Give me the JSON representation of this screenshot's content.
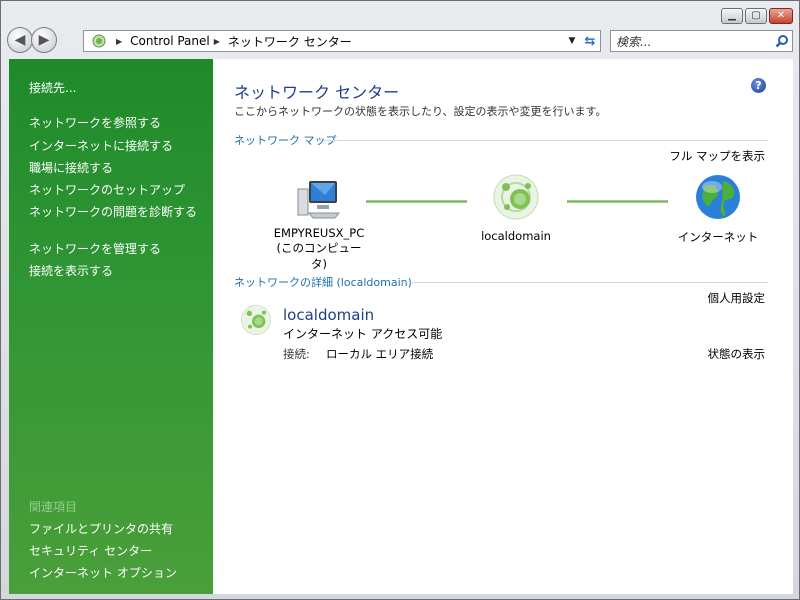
{
  "address": {
    "crumbs": [
      "Control Panel",
      "ネットワーク センター"
    ]
  },
  "search": {
    "placeholder": "検索..."
  },
  "sidebar": {
    "tasks": [
      "接続先...",
      "ネットワークを参照する",
      "インターネットに接続する",
      "職場に接続する",
      "ネットワークのセットアップ",
      "ネットワークの問題を診断する",
      "ネットワークを管理する",
      "接続を表示する"
    ],
    "related_header": "関連項目",
    "related": [
      "ファイルとプリンタの共有",
      "セキュリティ センター",
      "インターネット オプション"
    ]
  },
  "main": {
    "title": "ネットワーク センター",
    "description": "ここからネットワークの状態を表示したり、設定の表示や変更を行います。",
    "map_header": "ネットワーク マップ",
    "full_map_link": "フル マップを表示",
    "map_nodes": {
      "computer_name": "EMPYREUSX_PC",
      "computer_sub": "(このコンピュータ)",
      "network": "localdomain",
      "internet": "インターネット"
    },
    "details_header": "ネットワークの詳細 (localdomain)",
    "customize_link": "個人用設定",
    "network_name": "localdomain",
    "access": "インターネット アクセス可能",
    "connection_label": "接続:",
    "connection_value": "ローカル エリア接続",
    "view_status_link": "状態の表示"
  },
  "colors": {
    "sidebar": "#2f9534",
    "title": "#1e3f8a",
    "section": "#1e6fb0"
  }
}
